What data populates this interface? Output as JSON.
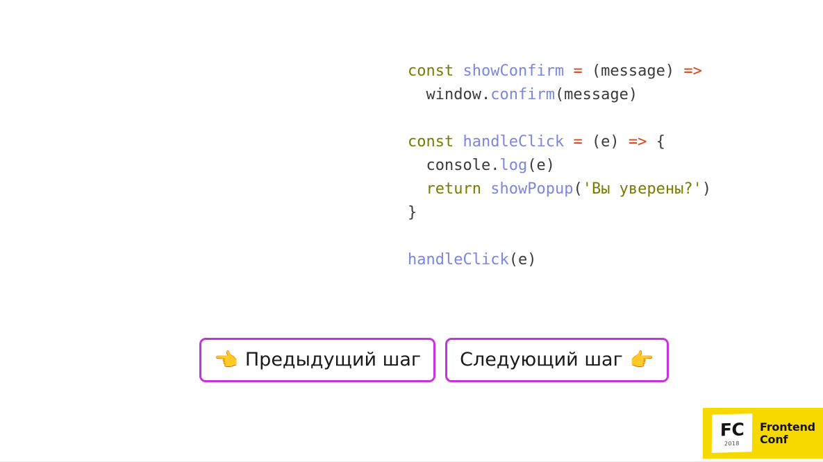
{
  "slide": {
    "background_color": "#ffffff",
    "accent_color": "#c732e0",
    "logo_background": "#f7d900"
  },
  "code": {
    "language": "javascript",
    "colors": {
      "keyword": "#7a7a00",
      "function": "#7b86e0",
      "operator": "#e2400f",
      "plain": "#3a3a3a",
      "string": "#7a7a00"
    },
    "lines": [
      {
        "tokens": [
          {
            "text": "const",
            "type": "keyword"
          },
          {
            "text": " ",
            "type": "plain"
          },
          {
            "text": "showConfirm",
            "type": "function"
          },
          {
            "text": " ",
            "type": "plain"
          },
          {
            "text": "=",
            "type": "operator"
          },
          {
            "text": " (message) ",
            "type": "plain"
          },
          {
            "text": "=>",
            "type": "operator"
          }
        ]
      },
      {
        "tokens": [
          {
            "text": "  window.",
            "type": "plain"
          },
          {
            "text": "confirm",
            "type": "function"
          },
          {
            "text": "(message)",
            "type": "plain"
          }
        ]
      },
      {
        "tokens": []
      },
      {
        "tokens": [
          {
            "text": "const",
            "type": "keyword"
          },
          {
            "text": " ",
            "type": "plain"
          },
          {
            "text": "handleClick",
            "type": "function"
          },
          {
            "text": " ",
            "type": "plain"
          },
          {
            "text": "=",
            "type": "operator"
          },
          {
            "text": " (e) ",
            "type": "plain"
          },
          {
            "text": "=>",
            "type": "operator"
          },
          {
            "text": " {",
            "type": "plain"
          }
        ]
      },
      {
        "tokens": [
          {
            "text": "  console.",
            "type": "plain"
          },
          {
            "text": "log",
            "type": "function"
          },
          {
            "text": "(e)",
            "type": "plain"
          }
        ]
      },
      {
        "tokens": [
          {
            "text": "  ",
            "type": "plain"
          },
          {
            "text": "return",
            "type": "keyword"
          },
          {
            "text": " ",
            "type": "plain"
          },
          {
            "text": "showPopup",
            "type": "function"
          },
          {
            "text": "(",
            "type": "plain"
          },
          {
            "text": "'Вы уверены?'",
            "type": "string"
          },
          {
            "text": ")",
            "type": "plain"
          }
        ]
      },
      {
        "tokens": [
          {
            "text": "}",
            "type": "plain"
          }
        ]
      },
      {
        "tokens": []
      },
      {
        "tokens": [
          {
            "text": "handleClick",
            "type": "function"
          },
          {
            "text": "(e)",
            "type": "plain"
          }
        ]
      }
    ]
  },
  "navigation": {
    "prev": {
      "icon": "👈",
      "icon_name": "pointing-left-hand-icon",
      "label": "Предыдущий шаг"
    },
    "next": {
      "icon": "👉",
      "icon_name": "pointing-right-hand-icon",
      "label": "Следующий шаг"
    }
  },
  "logo": {
    "mark_initials": "FC",
    "mark_year": "2018",
    "name_line1": "Frontend",
    "name_line2": "Conf"
  }
}
